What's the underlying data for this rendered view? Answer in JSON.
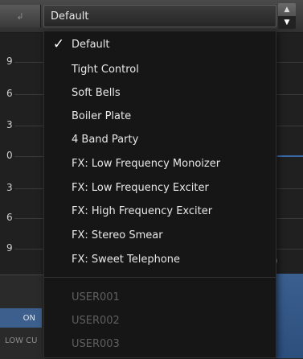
{
  "selector": {
    "value": "Default",
    "stepper_up": "▲",
    "stepper_down": "▼"
  },
  "graph": {
    "ticks": [
      "9",
      "6",
      "3",
      "0",
      "3",
      "6",
      "9"
    ],
    "stray_label": ")"
  },
  "bottom": {
    "on_label": "ON",
    "low_cut_label": "LOW CU"
  },
  "menu": {
    "checkmark": "✓",
    "selected": "Default",
    "items": [
      {
        "label": "Default",
        "enabled": true,
        "checked": true
      },
      {
        "label": "Tight Control",
        "enabled": true
      },
      {
        "label": "Soft Bells",
        "enabled": true
      },
      {
        "label": "Boiler Plate",
        "enabled": true
      },
      {
        "label": "4 Band Party",
        "enabled": true
      },
      {
        "label": "FX: Low Frequency Monoizer",
        "enabled": true
      },
      {
        "label": "FX: Low Frequency Exciter",
        "enabled": true
      },
      {
        "label": "FX: High Frequency Exciter",
        "enabled": true
      },
      {
        "label": "FX: Stereo Smear",
        "enabled": true
      },
      {
        "label": "FX: Sweet Telephone",
        "enabled": true
      },
      {
        "label": "USER001",
        "enabled": false
      },
      {
        "label": "USER002",
        "enabled": false
      },
      {
        "label": "USER003",
        "enabled": false
      }
    ]
  },
  "colors": {
    "menu_bg": "#161616",
    "menu_text": "#e8e8e8",
    "menu_disabled_text": "#5f5f5f",
    "accent_blue": "#3c5f8e"
  }
}
